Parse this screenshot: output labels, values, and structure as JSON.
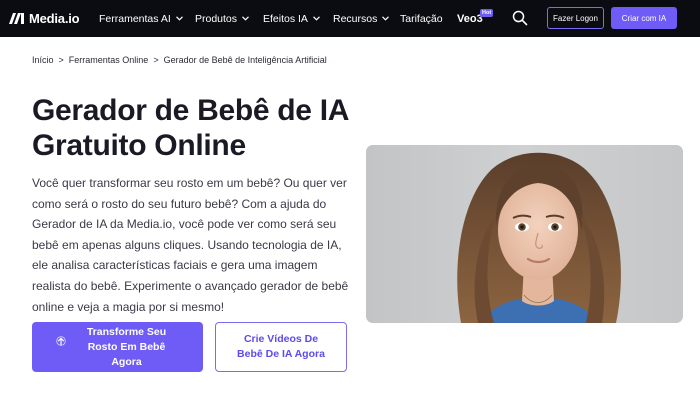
{
  "brand": {
    "name": "Media.io"
  },
  "nav": {
    "items": [
      {
        "label": "Ferramentas AI",
        "has_dropdown": true
      },
      {
        "label": "Produtos",
        "has_dropdown": true
      },
      {
        "label": "Efeitos IA",
        "has_dropdown": true
      },
      {
        "label": "Recursos",
        "has_dropdown": true
      },
      {
        "label": "Tarifação",
        "has_dropdown": false
      }
    ],
    "veo": {
      "label": "Veo3",
      "badge": "Hot"
    },
    "search_icon": "search-icon",
    "login_label": "Fazer Logon",
    "create_label": "Criar com IA"
  },
  "breadcrumb": {
    "items": [
      "Início",
      "Ferramentas Online",
      "Gerador de Bebê de Inteligência Artificial"
    ],
    "separator": ">"
  },
  "hero": {
    "title": "Gerador de Bebê de IA Gratuito Online",
    "description": "Você quer transformar seu rosto em um bebê? Ou quer ver como será o rosto do seu futuro bebê? Com a ajuda do Gerador de IA da Media.io, você pode ver como será seu bebê em apenas alguns cliques. Usando tecnologia de IA, ele analisa características faciais e gera uma imagem realista do bebê. Experimente o avançado gerador de bebê online e veja a magia por si mesmo!",
    "primary_cta": "Transforme Seu Rosto Em Bebê Agora",
    "primary_cta_icon": "upload-icon",
    "secondary_cta": "Crie Vídeos De Bebê De IA Agora"
  },
  "colors": {
    "nav_bg": "#0b0b12",
    "accent": "#6f5cf6",
    "accent_border": "#7b6cf6",
    "text_dark": "#1a1a24"
  }
}
